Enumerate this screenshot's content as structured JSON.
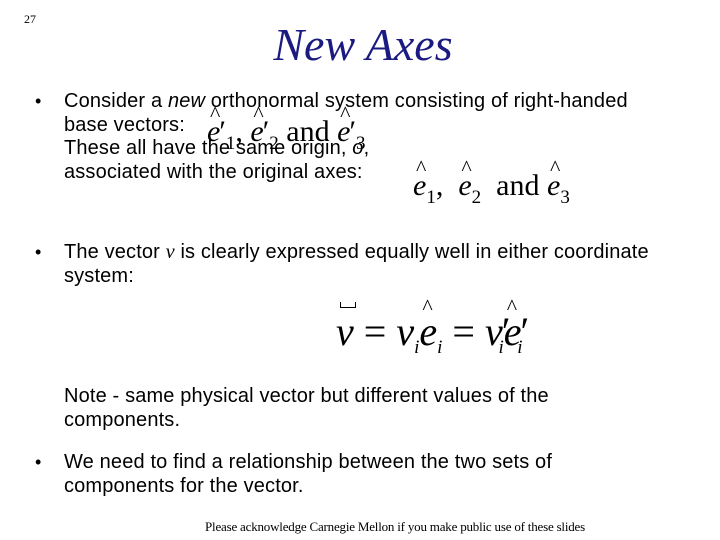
{
  "slide": {
    "number": "27",
    "title": "New Axes",
    "title_color": "#1a1a80"
  },
  "bullets": [
    {
      "line1_before": "Consider a ",
      "line1_em": "new",
      "line1_after": " orthonormal system consisting of right-handed",
      "line2": "base vectors:",
      "line3_before": "These all have the same origin, ",
      "line3_em": "o",
      "line3_after": ",",
      "line4": "associated with the original axes:"
    },
    {
      "line1_before": "The vector ",
      "line1_em": "v",
      "line1_after": " is clearly expressed equally well in either coordinate",
      "line2": "system:"
    },
    {
      "line1": "We need to find a relationship between the two sets of",
      "line2": "components for the vector."
    }
  ],
  "note": {
    "line1": "Note - same physical vector but different values of the",
    "line2": "components."
  },
  "math": {
    "new_basis": {
      "base": "e",
      "prime": "′",
      "subs": [
        "1",
        "2",
        "3"
      ],
      "comma": ",",
      "conj": "and"
    },
    "old_basis": {
      "base": "e",
      "subs": [
        "1",
        "2",
        "3"
      ],
      "comma": ",",
      "conj": "and"
    },
    "equation": {
      "lhs": "v",
      "eq": "=",
      "v": "v",
      "e": "e",
      "idx": "i",
      "prime": "′"
    }
  },
  "footer": "Please acknowledge Carnegie Mellon if you make public use of these slides"
}
